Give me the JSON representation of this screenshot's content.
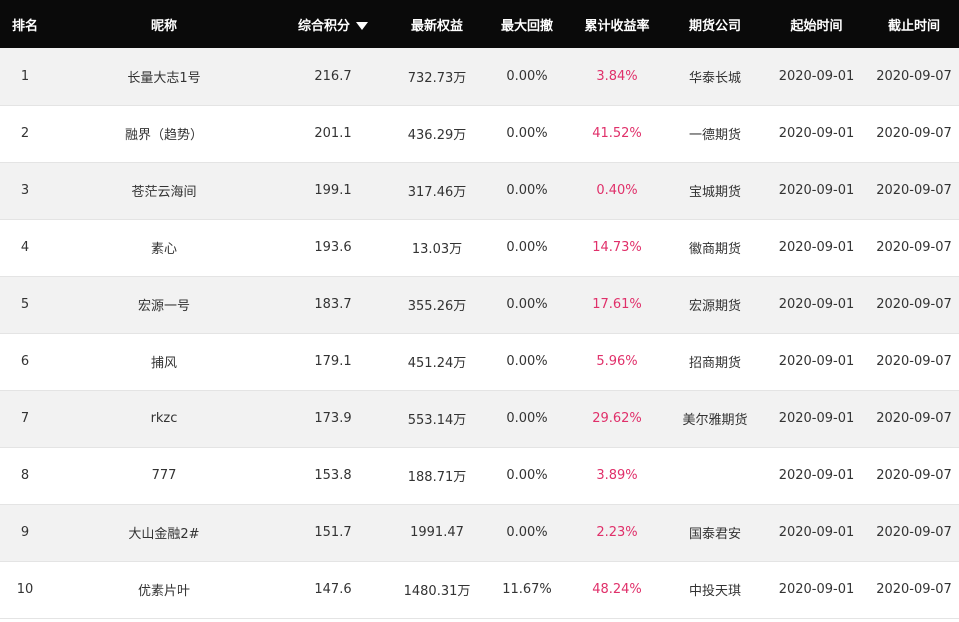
{
  "headers": {
    "rank": "排名",
    "nickname": "昵称",
    "score": "综合积分",
    "equity": "最新权益",
    "drawdown": "最大回撤",
    "return": "累计收益率",
    "company": "期货公司",
    "start": "起始时间",
    "end": "截止时间"
  },
  "sort_icon": "sort-desc-icon",
  "colors": {
    "header_bg": "#0a0a0a",
    "return_text": "#e0306a",
    "row_alt_bg": "#f2f2f2"
  },
  "rows": [
    {
      "rank": "1",
      "nickname": "长量大志1号",
      "score": "216.7",
      "equity": "732.73万",
      "drawdown": "0.00%",
      "return": "3.84%",
      "company": "华泰长城",
      "start": "2020-09-01",
      "end": "2020-09-07"
    },
    {
      "rank": "2",
      "nickname": "融界（趋势）",
      "score": "201.1",
      "equity": "436.29万",
      "drawdown": "0.00%",
      "return": "41.52%",
      "company": "一德期货",
      "start": "2020-09-01",
      "end": "2020-09-07"
    },
    {
      "rank": "3",
      "nickname": "苍茫云海间",
      "score": "199.1",
      "equity": "317.46万",
      "drawdown": "0.00%",
      "return": "0.40%",
      "company": "宝城期货",
      "start": "2020-09-01",
      "end": "2020-09-07"
    },
    {
      "rank": "4",
      "nickname": "素心",
      "score": "193.6",
      "equity": "13.03万",
      "drawdown": "0.00%",
      "return": "14.73%",
      "company": "徽商期货",
      "start": "2020-09-01",
      "end": "2020-09-07"
    },
    {
      "rank": "5",
      "nickname": "宏源一号",
      "score": "183.7",
      "equity": "355.26万",
      "drawdown": "0.00%",
      "return": "17.61%",
      "company": "宏源期货",
      "start": "2020-09-01",
      "end": "2020-09-07"
    },
    {
      "rank": "6",
      "nickname": "捕风",
      "score": "179.1",
      "equity": "451.24万",
      "drawdown": "0.00%",
      "return": "5.96%",
      "company": "招商期货",
      "start": "2020-09-01",
      "end": "2020-09-07"
    },
    {
      "rank": "7",
      "nickname": "rkzc",
      "score": "173.9",
      "equity": "553.14万",
      "drawdown": "0.00%",
      "return": "29.62%",
      "company": "美尔雅期货",
      "start": "2020-09-01",
      "end": "2020-09-07"
    },
    {
      "rank": "8",
      "nickname": "777",
      "score": "153.8",
      "equity": "188.71万",
      "drawdown": "0.00%",
      "return": "3.89%",
      "company": "",
      "start": "2020-09-01",
      "end": "2020-09-07"
    },
    {
      "rank": "9",
      "nickname": "大山金融2#",
      "score": "151.7",
      "equity": "1991.47",
      "drawdown": "0.00%",
      "return": "2.23%",
      "company": "国泰君安",
      "start": "2020-09-01",
      "end": "2020-09-07"
    },
    {
      "rank": "10",
      "nickname": "优素片叶",
      "score": "147.6",
      "equity": "1480.31万",
      "drawdown": "11.67%",
      "return": "48.24%",
      "company": "中投天琪",
      "start": "2020-09-01",
      "end": "2020-09-07"
    }
  ]
}
